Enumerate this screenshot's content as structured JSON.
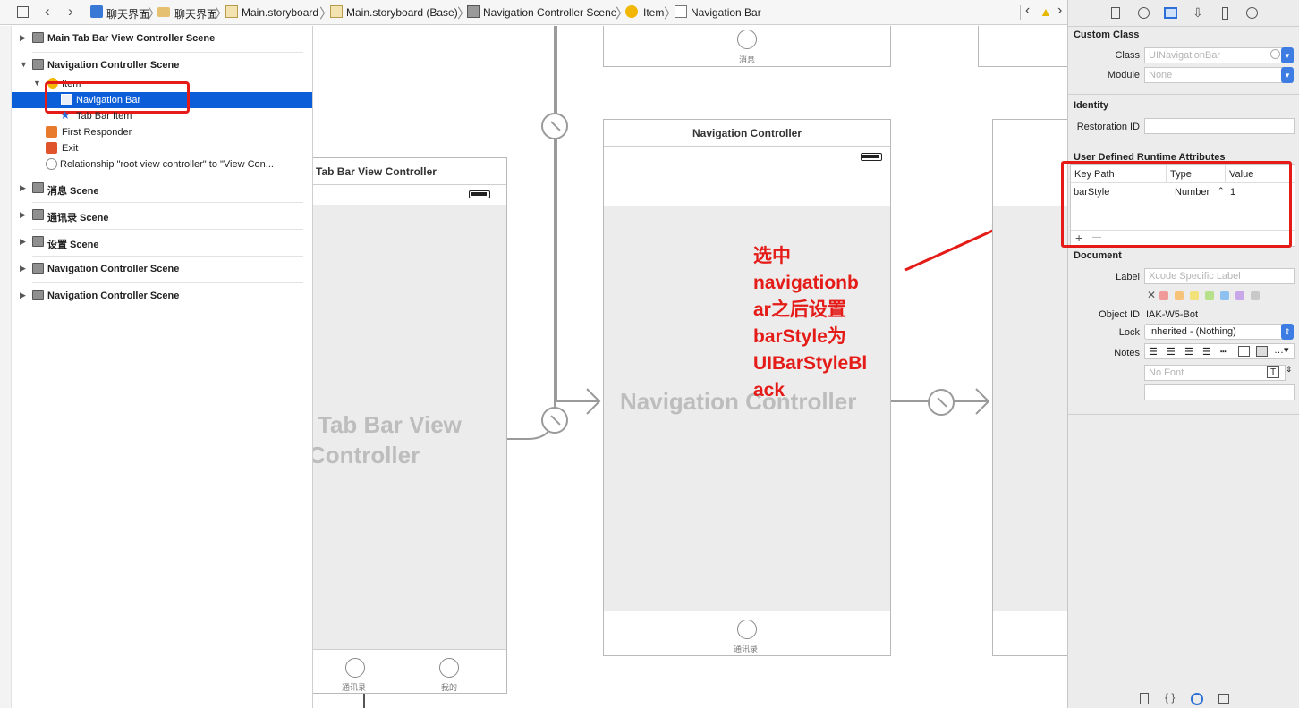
{
  "jumpbar": {
    "crumbs": [
      "聊天界面",
      "聊天界面",
      "Main.storyboard",
      "Main.storyboard (Base)",
      "Navigation Controller Scene",
      "Item",
      "Navigation Bar"
    ]
  },
  "outline": {
    "rows": [
      {
        "label": "Main Tab Bar View Controller Scene"
      },
      {
        "label": "Navigation Controller Scene"
      },
      {
        "label": "Item"
      },
      {
        "label": "Navigation Bar"
      },
      {
        "label": "Tab Bar Item"
      },
      {
        "label": "First Responder"
      },
      {
        "label": "Exit"
      },
      {
        "label": "Relationship \"root view controller\" to \"View Con..."
      },
      {
        "label": "消息 Scene"
      },
      {
        "label": "通讯录 Scene"
      },
      {
        "label": "设置 Scene"
      },
      {
        "label": "Navigation Controller Scene"
      },
      {
        "label": "Navigation Controller Scene"
      }
    ]
  },
  "canvas": {
    "top_scene_tab_label": "消息",
    "tabbar_scene": {
      "title": "Tab Bar View Controller",
      "watermark_line1": "Tab Bar View",
      "watermark_line2": "Controller",
      "tab1": "通讯录",
      "tab2": "我的"
    },
    "nav_scene": {
      "title": "Navigation Controller",
      "watermark": "Navigation Controller",
      "tab": "通讯录"
    },
    "annotation": [
      "选中",
      "navigationb",
      "ar之后设置",
      "barStyle为",
      "UIBarStyleBl",
      "ack"
    ],
    "annotation_color": "#e41b17"
  },
  "inspector": {
    "custom_class": {
      "title": "Custom Class",
      "class_label": "Class",
      "class_placeholder": "UINavigationBar",
      "module_label": "Module",
      "module_placeholder": "None"
    },
    "identity": {
      "title": "Identity",
      "restoration_label": "Restoration ID"
    },
    "runtime_attrs": {
      "title": "User Defined Runtime Attributes",
      "headers": [
        "Key Path",
        "Type",
        "Value"
      ],
      "rows": [
        {
          "key": "barStyle",
          "type": "Number",
          "value": "1"
        }
      ],
      "add": "+",
      "remove": "—"
    },
    "document": {
      "title": "Document",
      "label_label": "Label",
      "label_placeholder": "Xcode Specific Label",
      "objectid_label": "Object ID",
      "objectid_value": "IAK-W5-Bot",
      "lock_label": "Lock",
      "lock_value": "Inherited - (Nothing)",
      "notes_label": "Notes",
      "font_placeholder": "No Font",
      "font_icon": "T"
    },
    "accent": "#3d7de3"
  }
}
